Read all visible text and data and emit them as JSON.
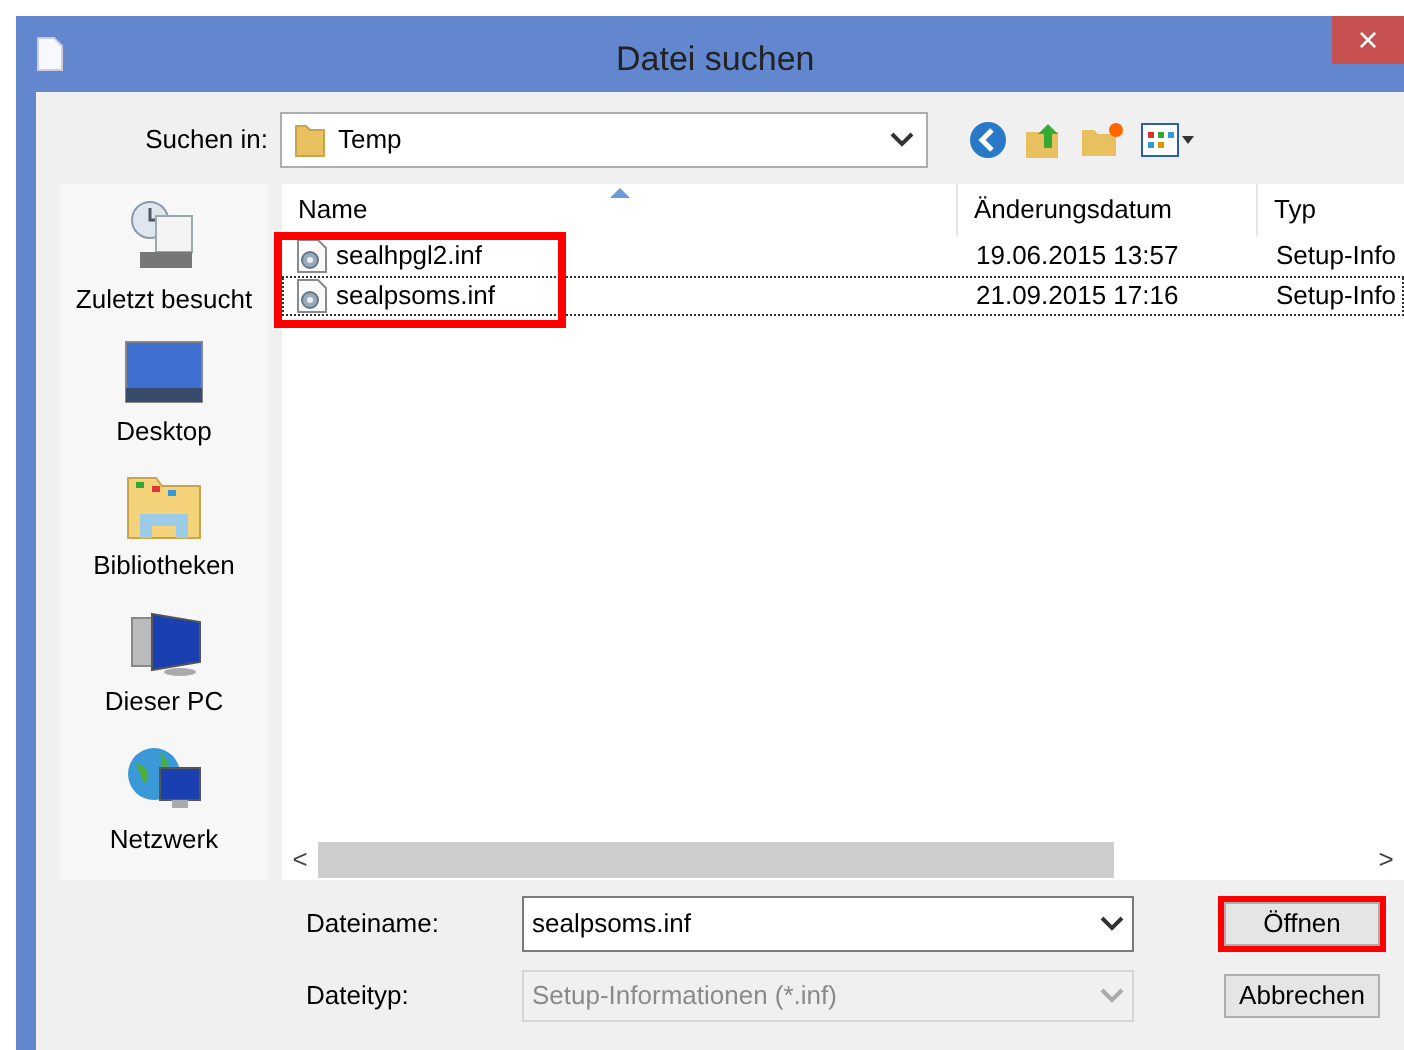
{
  "window": {
    "title": "Datei suchen",
    "close": "×"
  },
  "look_in": {
    "label": "Suchen in:",
    "value": "Temp"
  },
  "places": [
    {
      "label": "Zuletzt besucht",
      "kind": "recent"
    },
    {
      "label": "Desktop",
      "kind": "desktop"
    },
    {
      "label": "Bibliotheken",
      "kind": "libraries"
    },
    {
      "label": "Dieser PC",
      "kind": "pc"
    },
    {
      "label": "Netzwerk",
      "kind": "network"
    }
  ],
  "table": {
    "columns": [
      "Name",
      "Änderungsdatum",
      "Typ"
    ],
    "highlighted": true,
    "rows": [
      {
        "name": "sealhpgl2.inf",
        "date": "19.06.2015 13:57",
        "type": "Setup-Info",
        "focused": false
      },
      {
        "name": "sealpsoms.inf",
        "date": "21.09.2015 17:16",
        "type": "Setup-Info",
        "focused": true
      }
    ]
  },
  "filename": {
    "label": "Dateiname:",
    "value": "sealpsoms.inf"
  },
  "filetype": {
    "label": "Dateityp:",
    "value": "Setup-Informationen (*.inf)",
    "disabled": true
  },
  "buttons": [
    {
      "label": "Öffnen",
      "highlighted": true
    },
    {
      "label": "Abbrechen",
      "highlighted": false
    }
  ],
  "scroll": {
    "left": "<",
    "right": ">"
  }
}
